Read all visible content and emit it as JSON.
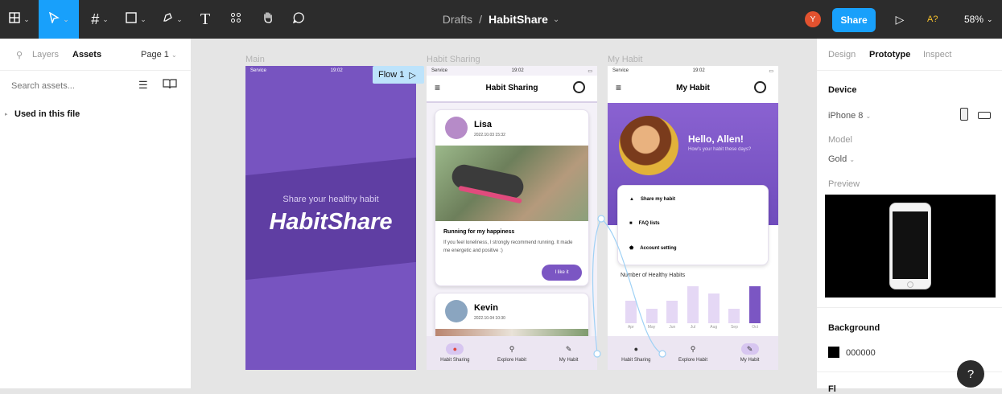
{
  "toolbar": {
    "tools": [
      "main-menu",
      "move",
      "frame",
      "shape",
      "pen",
      "text",
      "resources",
      "hand",
      "comment"
    ],
    "text_tool_glyph": "T",
    "breadcrumb_parent": "Drafts",
    "separator": "/",
    "file_name": "HabitShare",
    "avatar_initial": "Y",
    "share_label": "Share",
    "ai_label": "A?",
    "zoom": "58%"
  },
  "left_panel": {
    "tab_layers": "Layers",
    "tab_assets": "Assets",
    "page": "Page 1",
    "search_placeholder": "Search assets...",
    "section": "Used in this file"
  },
  "canvas": {
    "frame_main_label": "Main",
    "frame_sharing_label": "Habit Sharing",
    "frame_myhabit_label": "My Habit",
    "flow_label": "Flow 1",
    "main": {
      "status_left": "Service",
      "status_time": "19:02",
      "tagline": "Share your healthy habit",
      "logo": "HabitShare"
    },
    "sharing": {
      "status_left": "Service",
      "status_time": "19:02",
      "title": "Habit Sharing",
      "post1_user": "Lisa",
      "post1_date": "2022.10.03 15:32",
      "post1_title": "Running for my happiness",
      "post1_body": "If you feel loneliness, I strongly recommend running. It made me energetic and positive :)",
      "post1_button": "I like it",
      "post2_user": "Kevin",
      "post2_date": "2022.10.04 10:30",
      "nav": [
        "Habit Sharing",
        "Explore Habit",
        "My Habit"
      ]
    },
    "myhabit": {
      "status_left": "Service",
      "status_time": "19:02",
      "title": "My Habit",
      "greeting": "Hello, Allen!",
      "subgreeting": "How's your habit these days?",
      "menu": [
        "Share my habit",
        "FAQ lists",
        "Account setting"
      ],
      "chart_title": "Number of Healthy Habits",
      "nav": [
        "Habit Sharing",
        "Explore Habit",
        "My Habit"
      ]
    }
  },
  "chart_data": {
    "type": "bar",
    "title": "Number of Healthy Habits",
    "categories": [
      "Apr",
      "May",
      "Jun",
      "Jul",
      "Aug",
      "Sep",
      "Oct"
    ],
    "values": [
      3,
      2,
      3,
      5,
      4,
      2,
      5
    ],
    "highlight_color": "#7b56c3",
    "bar_color": "#e5d8f5"
  },
  "right_panel": {
    "tab_design": "Design",
    "tab_prototype": "Prototype",
    "tab_inspect": "Inspect",
    "device_heading": "Device",
    "device_value": "iPhone 8",
    "model_label": "Model",
    "model_value": "Gold",
    "preview_label": "Preview",
    "background_heading": "Background",
    "background_value": "000000",
    "background_color": "#000000",
    "cutoff_heading": "Fl",
    "help_label": "?"
  },
  "colors": {
    "accent": "#18a0fb",
    "purple": "#7b56c3",
    "toolbar": "#2c2c2c"
  }
}
